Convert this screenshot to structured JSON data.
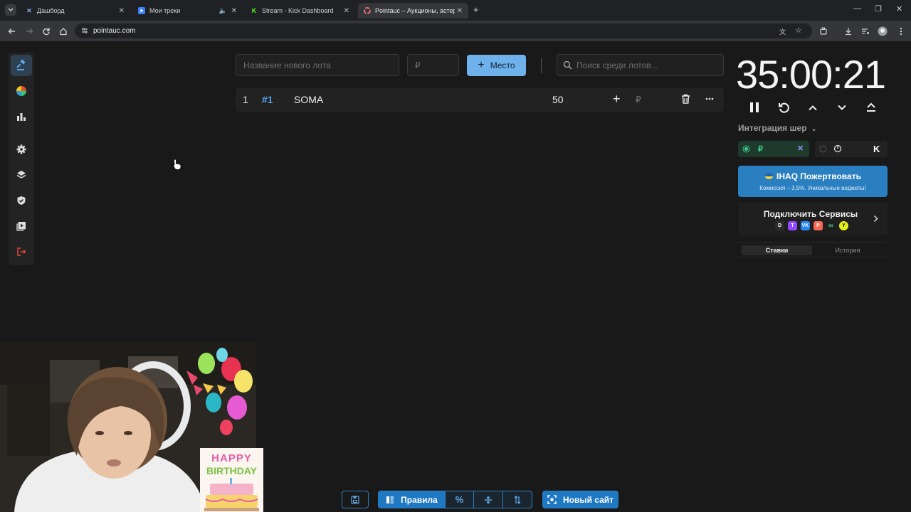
{
  "browser": {
    "tabs": [
      {
        "label": "Дашборд",
        "favicon": "x-brand-icon"
      },
      {
        "label": "Мои треки",
        "favicon": "play-icon",
        "audio": true
      },
      {
        "label": "Stream - Kick Dashboard",
        "favicon": "kick-icon"
      },
      {
        "label": "Pointauc – Аукционы, астерео",
        "favicon": "pointauc-icon",
        "active": true
      }
    ],
    "url": "pointauc.com"
  },
  "sidebar": {
    "items": [
      {
        "name": "auction-icon",
        "active": true
      },
      {
        "name": "wheel-icon"
      },
      {
        "name": "stats-icon"
      },
      {
        "name": "settings-icon"
      },
      {
        "name": "layers-icon"
      },
      {
        "name": "shield-icon"
      },
      {
        "name": "video-icon"
      },
      {
        "name": "logout-icon"
      }
    ]
  },
  "toolbar": {
    "lot_name_placeholder": "Название нового лота",
    "amount_placeholder": "₽",
    "add_place_label": "Место",
    "search_placeholder": "Поиск среди лотов..."
  },
  "lots": [
    {
      "index": "1",
      "id": "#1",
      "name": "SOMA",
      "amount": "50",
      "currency": "₽"
    }
  ],
  "timer": {
    "value": "35:00:21"
  },
  "integration": {
    "label": "Интеграция шер",
    "currency_symbol": "₽"
  },
  "donate": {
    "title": "IHAQ Пожертвовать",
    "subtitle": "Комиссия – 3,5%. Уникальные виджеты!"
  },
  "connect": {
    "title": "Подключить Сервисы",
    "services": [
      "D",
      "T",
      "VK",
      "P",
      "∞",
      "Y"
    ]
  },
  "history_tabs": {
    "bids": "Ставки",
    "history": "История"
  },
  "bottom": {
    "rules_label": "Правила",
    "new_site_label": "Новый сайт"
  },
  "overlay": {
    "birthday_text_1": "HAPPY",
    "birthday_text_2": "BIRTHDAY"
  },
  "colors": {
    "accent": "#6eb1eb",
    "primary_blue": "#1f78c3",
    "bg": "#191919"
  }
}
